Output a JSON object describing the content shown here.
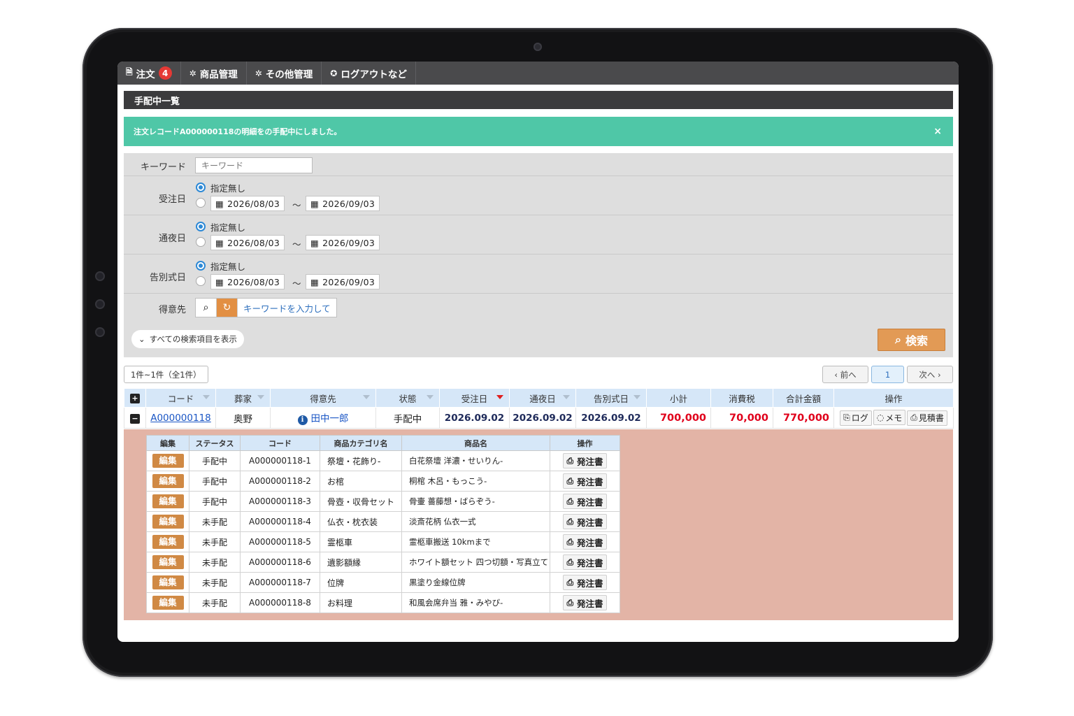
{
  "nav": {
    "items": [
      {
        "label": "注文",
        "icon": "document-icon",
        "badge": "4"
      },
      {
        "label": "商品管理",
        "icon": "gear-icon"
      },
      {
        "label": "その他管理",
        "icon": "gear-icon"
      },
      {
        "label": "ログアウトなど",
        "icon": "gear-icon"
      }
    ]
  },
  "page_title": "手配中一覧",
  "alert": {
    "message": "注文レコードA000000118の明細をの手配中にしました。",
    "close": "×"
  },
  "search": {
    "keyword": {
      "label": "キーワード",
      "placeholder": "キーワード"
    },
    "date_fields": [
      {
        "label": "受注日",
        "option_none": "指定無し",
        "from": "2026/08/03",
        "to": "2026/09/03"
      },
      {
        "label": "通夜日",
        "option_none": "指定無し",
        "from": "2026/08/03",
        "to": "2026/09/03"
      },
      {
        "label": "告別式日",
        "option_none": "指定無し",
        "from": "2026/08/03",
        "to": "2026/09/03"
      }
    ],
    "range_separator": "〜",
    "customer": {
      "label": "得意先",
      "placeholder": "キーワードを入力して"
    },
    "show_all_label": "すべての検索項目を表示",
    "search_button": "検索"
  },
  "pagination": {
    "count_text": "1件~1件（全1件）",
    "prev": "前へ",
    "current": "1",
    "next": "次へ"
  },
  "table": {
    "headers": [
      "コード",
      "葬家",
      "得意先",
      "状態",
      "受注日",
      "通夜日",
      "告別式日",
      "小計",
      "消費税",
      "合計金額",
      "操作"
    ],
    "row": {
      "code": "A000000118",
      "family": "奥野",
      "customer": "田中一郎",
      "status": "手配中",
      "order_date": "2026.09.02",
      "wake_date": "2026.09.02",
      "funeral_date": "2026.09.02",
      "subtotal": "700,000",
      "tax": "70,000",
      "total": "770,000",
      "actions": {
        "log": "ログ",
        "memo": "メモ",
        "estimate": "見積書"
      }
    }
  },
  "detail": {
    "headers": [
      "編集",
      "ステータス",
      "コード",
      "商品カテゴリ名",
      "商品名",
      "操作"
    ],
    "edit_label": "編集",
    "order_label": "発注書",
    "rows": [
      {
        "status": "手配中",
        "code": "A000000118-1",
        "category": "祭壇・花飾り-",
        "product": "白花祭壇 洋濃・せいりん-"
      },
      {
        "status": "手配中",
        "code": "A000000118-2",
        "category": "お棺",
        "product": "桐棺 木呂・もっこう-"
      },
      {
        "status": "手配中",
        "code": "A000000118-3",
        "category": "骨壺・収骨セット",
        "product": "骨壷 薔藤想・ばらぞう-"
      },
      {
        "status": "未手配",
        "code": "A000000118-4",
        "category": "仏衣・枕衣装",
        "product": "淡斎花柄 仏衣一式"
      },
      {
        "status": "未手配",
        "code": "A000000118-5",
        "category": "霊柩車",
        "product": "霊柩車搬送 10kmまで"
      },
      {
        "status": "未手配",
        "code": "A000000118-6",
        "category": "遺影額縁",
        "product": "ホワイト額セット 四つ切額・写真立て"
      },
      {
        "status": "未手配",
        "code": "A000000118-7",
        "category": "位牌",
        "product": "黒塗り金線位牌"
      },
      {
        "status": "未手配",
        "code": "A000000118-8",
        "category": "お料理",
        "product": "和風会席弁当 雅・みやび-"
      }
    ]
  },
  "colors": {
    "accent": "#e29a55",
    "alert": "#4fc7a7",
    "detail_bg": "#e3b4a6",
    "money": "#e0001b"
  }
}
